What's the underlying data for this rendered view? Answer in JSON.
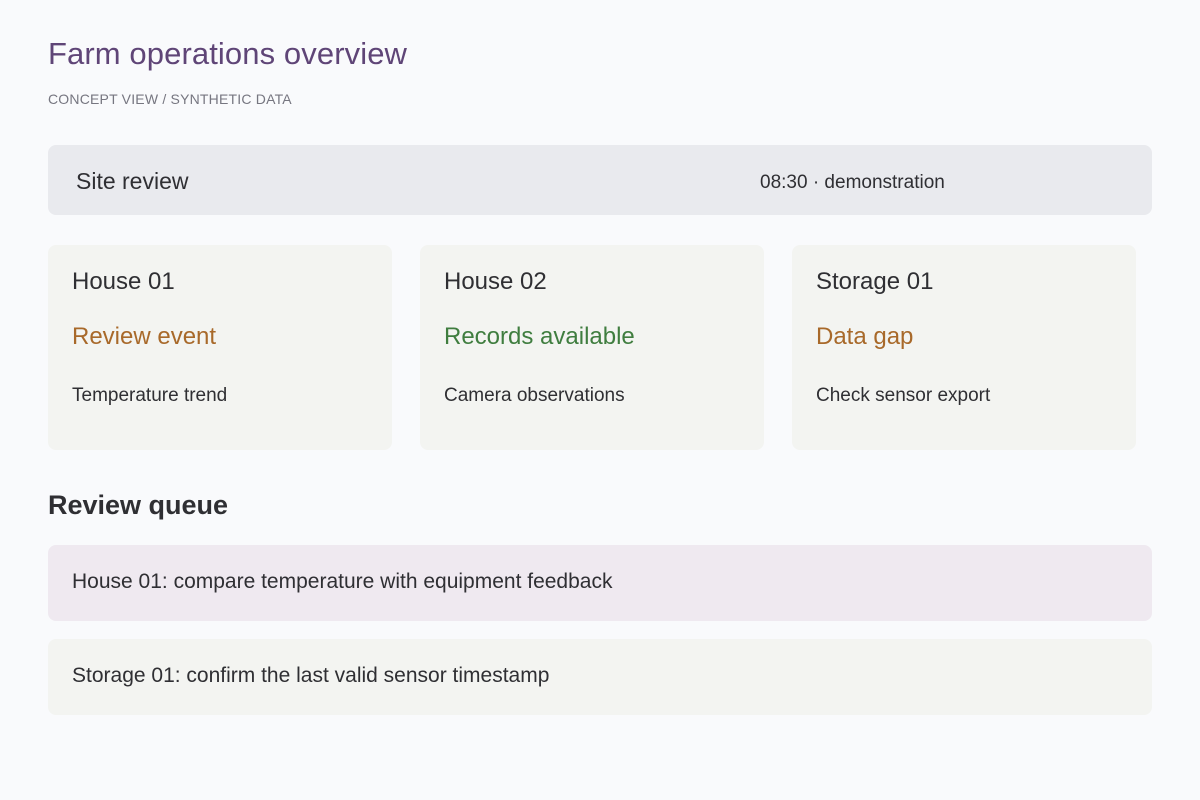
{
  "header": {
    "title": "Farm operations overview",
    "subtitle": "CONCEPT VIEW / SYNTHETIC DATA"
  },
  "site_bar": {
    "label": "Site review",
    "meta": "08:30 · demonstration"
  },
  "cards": [
    {
      "name": "House 01",
      "status": "Review event",
      "status_color": "#a8692a",
      "detail": "Temperature trend"
    },
    {
      "name": "House 02",
      "status": "Records available",
      "status_color": "#3f7d3f",
      "detail": "Camera observations"
    },
    {
      "name": "Storage 01",
      "status": "Data gap",
      "status_color": "#a8692a",
      "detail": "Check sensor export"
    }
  ],
  "queue": {
    "title": "Review queue",
    "items": [
      {
        "text": "House 01: compare temperature with equipment feedback",
        "bg": "#efe9f0"
      },
      {
        "text": "Storage 01: confirm the last valid sensor timestamp",
        "bg": "#f3f4f1"
      }
    ]
  },
  "colors": {
    "title": "#5f4577",
    "background": "#f9fafc",
    "site_bar": "#e9eaee",
    "card": "#f3f4f1"
  }
}
